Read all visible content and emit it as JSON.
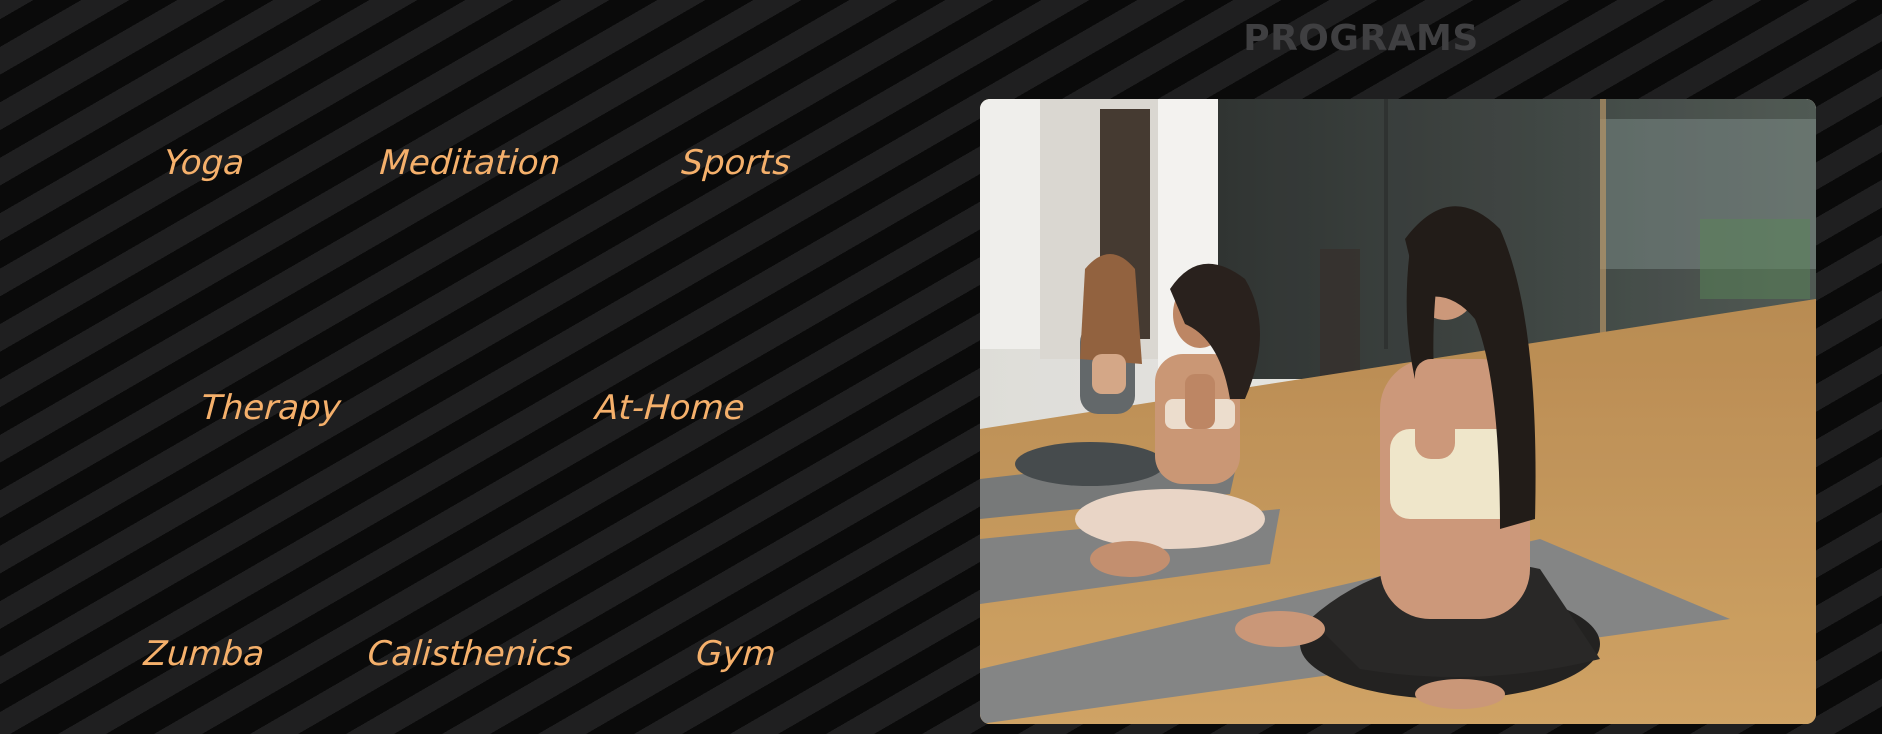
{
  "programs_section": {
    "title": "PROGRAMS",
    "programs": [
      "Yoga",
      "Meditation",
      "Sports",
      "Therapy",
      "At-Home",
      "Zumba",
      "Calisthenics",
      "Gym"
    ],
    "photo": {
      "subject": "three women meditating on yoga mats"
    },
    "colors": {
      "program_text": "#f5b06b",
      "title_text": "#3f3f41",
      "stripe_dark": "#0a0a0a",
      "stripe_light": "#1f1f20"
    }
  }
}
